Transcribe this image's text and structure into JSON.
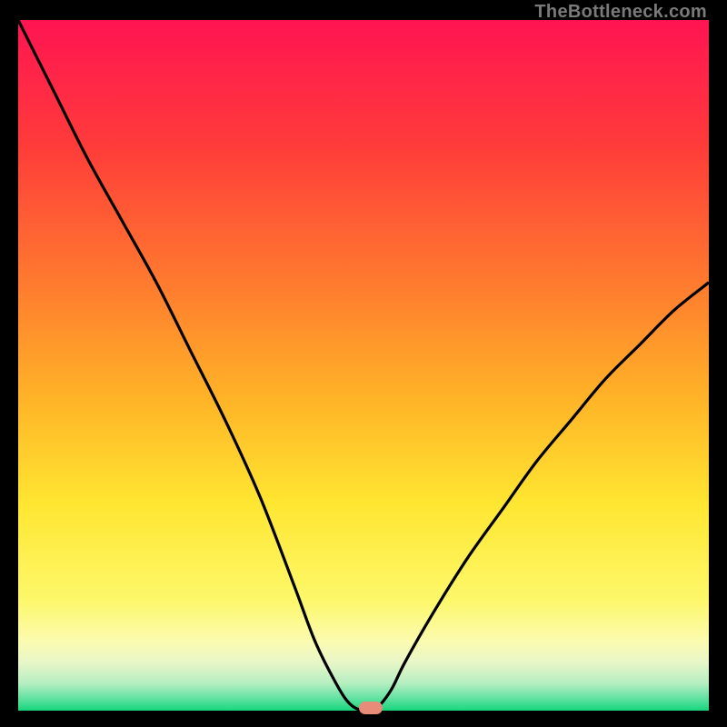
{
  "watermark": "TheBottleneck.com",
  "colors": {
    "page_bg": "#000000",
    "curve": "#000000",
    "marker": "#e98b79",
    "gradient_stops": [
      {
        "pct": 0,
        "color": "#ff1452"
      },
      {
        "pct": 18,
        "color": "#ff3b3a"
      },
      {
        "pct": 38,
        "color": "#ff7a2f"
      },
      {
        "pct": 55,
        "color": "#ffb427"
      },
      {
        "pct": 70,
        "color": "#ffe631"
      },
      {
        "pct": 84,
        "color": "#fdf86a"
      },
      {
        "pct": 90,
        "color": "#fbfbb0"
      },
      {
        "pct": 93,
        "color": "#e8f6c7"
      },
      {
        "pct": 96,
        "color": "#b7efc2"
      },
      {
        "pct": 98,
        "color": "#6be3a5"
      },
      {
        "pct": 100,
        "color": "#16d67c"
      }
    ]
  },
  "chart_data": {
    "type": "line",
    "title": "",
    "xlabel": "",
    "ylabel": "",
    "xlim": [
      0,
      100
    ],
    "ylim": [
      0,
      100
    ],
    "series": [
      {
        "name": "bottleneck-curve",
        "x": [
          0,
          5,
          10,
          15,
          20,
          25,
          30,
          35,
          40,
          43,
          46,
          48,
          50,
          52,
          54,
          56,
          60,
          65,
          70,
          75,
          80,
          85,
          90,
          95,
          100
        ],
        "values": [
          100,
          90,
          80,
          71,
          62,
          52,
          42,
          31,
          18,
          10,
          4,
          1,
          0,
          0.5,
          3,
          7,
          14,
          22,
          29,
          36,
          42,
          48,
          53,
          58,
          62
        ]
      }
    ],
    "marker": {
      "x": 51,
      "y": 0
    },
    "flat_bottom": {
      "x_from": 47,
      "x_to": 51,
      "y": 0
    }
  }
}
